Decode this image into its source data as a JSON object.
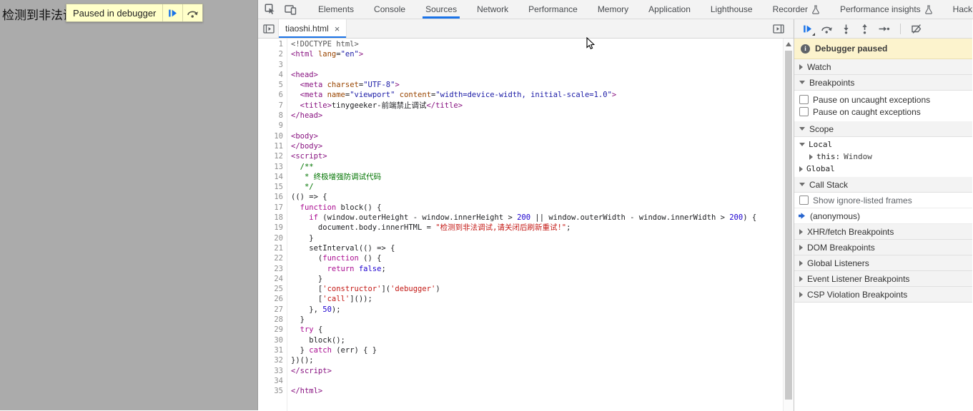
{
  "colors": {
    "accent": "#1a73e8",
    "page_bg": "#ababab",
    "overlay_bg": "#ffffc9",
    "paused_banner_bg": "#fcf3cd",
    "syntax": {
      "tag": "#881280",
      "attr": "#994500",
      "attrval": "#1a1aa6",
      "kw": "#aa0d91",
      "num": "#1c00cf",
      "str": "#c41a16",
      "com": "#007400",
      "meta": "#555555",
      "text": "#202124"
    }
  },
  "page": {
    "body_text": "检测到非法调试,请关闭后刷新重试!",
    "overlay": {
      "label": "Paused in debugger"
    }
  },
  "devtools": {
    "main_tabs": [
      {
        "label": "Elements"
      },
      {
        "label": "Console"
      },
      {
        "label": "Sources",
        "active": true
      },
      {
        "label": "Network"
      },
      {
        "label": "Performance"
      },
      {
        "label": "Memory"
      },
      {
        "label": "Application"
      },
      {
        "label": "Lighthouse"
      },
      {
        "label": "Recorder",
        "flask": true
      },
      {
        "label": "Performance insights",
        "flask": true
      },
      {
        "label": "HackBar"
      }
    ],
    "sources": {
      "file_tab": {
        "label": "tiaoshi.html",
        "close_glyph": "×"
      },
      "editor": {
        "lines": [
          [
            [
              "meta",
              "<!DOCTYPE html>"
            ]
          ],
          [
            [
              "tag",
              "<html "
            ],
            [
              "attr",
              "lang"
            ],
            [
              "plain",
              "="
            ],
            [
              "attrval",
              "\"en\""
            ],
            [
              "tag",
              ">"
            ]
          ],
          [],
          [
            [
              "tag",
              "<head>"
            ]
          ],
          [
            [
              "plain",
              "  "
            ],
            [
              "tag",
              "<meta "
            ],
            [
              "attr",
              "charset"
            ],
            [
              "plain",
              "="
            ],
            [
              "attrval",
              "\"UTF-8\""
            ],
            [
              "tag",
              ">"
            ]
          ],
          [
            [
              "plain",
              "  "
            ],
            [
              "tag",
              "<meta "
            ],
            [
              "attr",
              "name"
            ],
            [
              "plain",
              "="
            ],
            [
              "attrval",
              "\"viewport\""
            ],
            [
              "plain",
              " "
            ],
            [
              "attr",
              "content"
            ],
            [
              "plain",
              "="
            ],
            [
              "attrval",
              "\"width=device-width, initial-scale=1.0\""
            ],
            [
              "tag",
              ">"
            ]
          ],
          [
            [
              "plain",
              "  "
            ],
            [
              "tag",
              "<title>"
            ],
            [
              "plain",
              "tinygeeker-前端禁止调试"
            ],
            [
              "tag",
              "</title>"
            ]
          ],
          [
            [
              "tag",
              "</head>"
            ]
          ],
          [],
          [
            [
              "tag",
              "<body>"
            ]
          ],
          [
            [
              "tag",
              "</body>"
            ]
          ],
          [
            [
              "tag",
              "<script>"
            ]
          ],
          [
            [
              "com",
              "  /**"
            ]
          ],
          [
            [
              "com",
              "   * 终极增强防调试代码"
            ]
          ],
          [
            [
              "com",
              "   */"
            ]
          ],
          [
            [
              "plain",
              "(() => {"
            ]
          ],
          [
            [
              "plain",
              "  "
            ],
            [
              "kw",
              "function"
            ],
            [
              "plain",
              " block() {"
            ]
          ],
          [
            [
              "plain",
              "    "
            ],
            [
              "kw",
              "if"
            ],
            [
              "plain",
              " (window.outerHeight - window.innerHeight > "
            ],
            [
              "num",
              "200"
            ],
            [
              "plain",
              " || window.outerWidth - window.innerWidth > "
            ],
            [
              "num",
              "200"
            ],
            [
              "plain",
              ") {"
            ]
          ],
          [
            [
              "plain",
              "      document.body.innerHTML = "
            ],
            [
              "str",
              "\"检测到非法调试,请关闭后刷新重试!\""
            ],
            [
              "plain",
              ";"
            ]
          ],
          [
            [
              "plain",
              "    }"
            ]
          ],
          [
            [
              "plain",
              "    setInterval(() => {"
            ]
          ],
          [
            [
              "plain",
              "      ("
            ],
            [
              "kw",
              "function"
            ],
            [
              "plain",
              " () {"
            ]
          ],
          [
            [
              "plain",
              "        "
            ],
            [
              "kw",
              "return"
            ],
            [
              "plain",
              " "
            ],
            [
              "num",
              "false"
            ],
            [
              "plain",
              ";"
            ]
          ],
          [
            [
              "plain",
              "      }"
            ]
          ],
          [
            [
              "plain",
              "      ["
            ],
            [
              "str",
              "'constructor'"
            ],
            [
              "plain",
              "]("
            ],
            [
              "str",
              "'debugger'"
            ],
            [
              "plain",
              ")"
            ]
          ],
          [
            [
              "plain",
              "      ["
            ],
            [
              "str",
              "'call'"
            ],
            [
              "plain",
              "]());"
            ]
          ],
          [
            [
              "plain",
              "    }, "
            ],
            [
              "num",
              "50"
            ],
            [
              "plain",
              ");"
            ]
          ],
          [
            [
              "plain",
              "  }"
            ]
          ],
          [
            [
              "plain",
              "  "
            ],
            [
              "kw",
              "try"
            ],
            [
              "plain",
              " {"
            ]
          ],
          [
            [
              "plain",
              "    block();"
            ]
          ],
          [
            [
              "plain",
              "  } "
            ],
            [
              "kw",
              "catch"
            ],
            [
              "plain",
              " (err) { }"
            ]
          ],
          [
            [
              "plain",
              "})();"
            ]
          ],
          [
            [
              "tag",
              "</script>"
            ]
          ],
          [],
          [
            [
              "tag",
              "</html>"
            ]
          ]
        ]
      },
      "debugger": {
        "paused_banner": "Debugger paused",
        "watch_label": "Watch",
        "breakpoints_label": "Breakpoints",
        "breakpoint_options": [
          "Pause on uncaught exceptions",
          "Pause on caught exceptions"
        ],
        "scope_label": "Scope",
        "scope": {
          "local": "Local",
          "this_name": "this:",
          "this_value": "Window",
          "global": "Global"
        },
        "call_stack_label": "Call Stack",
        "call_stack_option": "Show ignore-listed frames",
        "frames": [
          "(anonymous)"
        ],
        "more_sections": [
          "XHR/fetch Breakpoints",
          "DOM Breakpoints",
          "Global Listeners",
          "Event Listener Breakpoints",
          "CSP Violation Breakpoints"
        ]
      }
    }
  }
}
